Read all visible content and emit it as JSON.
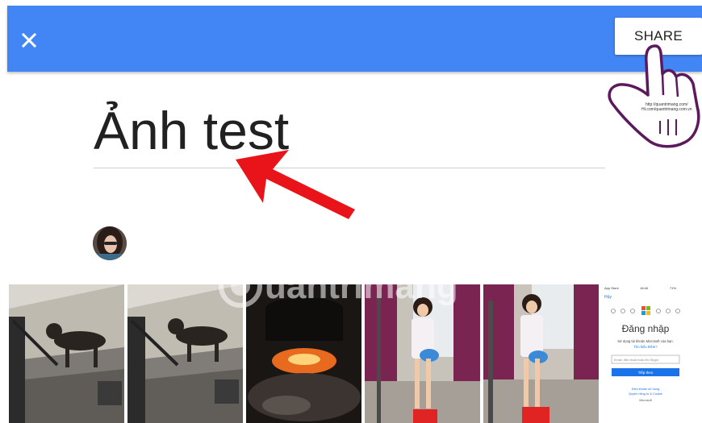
{
  "appbar": {
    "close_icon": "close-icon",
    "share_label": "SHARE",
    "color": "#4285f4"
  },
  "album": {
    "title": "Ảnh test"
  },
  "annotation": {
    "hand_text_1": "http://quantrimang.com/",
    "hand_text_2": "Ht.com/quantrimang.com.vn",
    "arrow_color": "#e8141a"
  },
  "watermark": {
    "text": "uantrimang"
  },
  "photos": [
    {
      "description_icon": "dog-stairs-photo"
    },
    {
      "description_icon": "dog-stairs-photo"
    },
    {
      "description_icon": "fire-pot-photo"
    },
    {
      "description_icon": "child-drum-photo"
    },
    {
      "description_icon": "child-drum-photo"
    },
    {
      "description_icon": "microsoft-login-screenshot"
    }
  ],
  "microsoft_screenshot": {
    "status_left": "App Store",
    "status_time": "18:46",
    "status_right": "71%",
    "cancel": "Hủy",
    "heading": "Đăng nhập",
    "subtitle": "Sử dụng tài khoản Microsoft của bạn.",
    "link": "Tìm hiểu thêm?",
    "input_placeholder": "Email, điện thoại hoặc tên Skype",
    "button": "Tiếp theo",
    "footer_1": "Điều khoản sử dụng",
    "footer_2": "Quyền riêng tư & Cookie",
    "footer_3": "Microsoft"
  }
}
